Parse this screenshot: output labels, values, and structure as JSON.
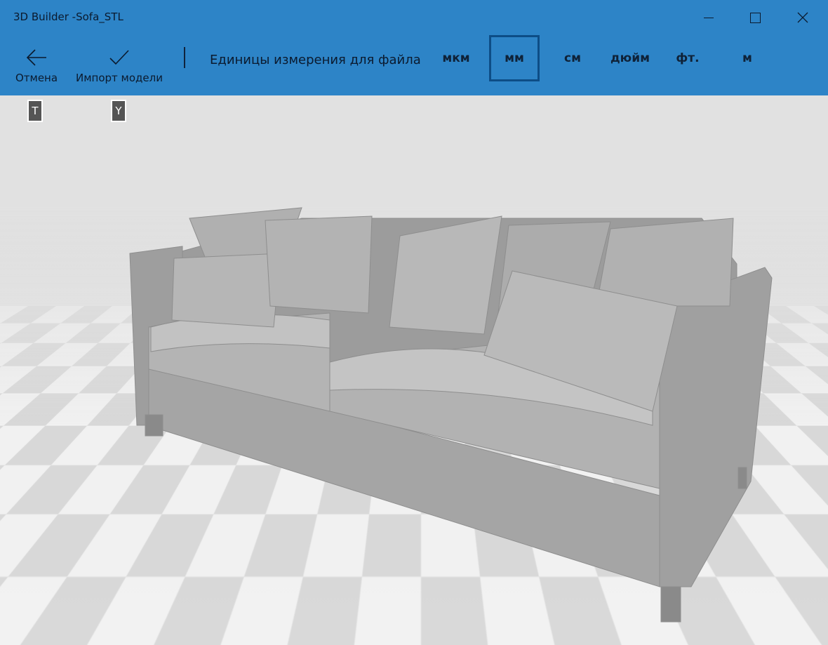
{
  "window": {
    "title": "3D Builder -Sofa_STL"
  },
  "toolbar": {
    "cancel_label": "Отмена",
    "import_label": "Импорт модели",
    "units_label": "Единицы измерения для файла",
    "units": [
      "мкм",
      "мм",
      "см",
      "дюйм",
      "фт.",
      "м"
    ],
    "selected_unit": "мм"
  },
  "shortcuts": {
    "cancel": "T",
    "import": "Y"
  },
  "colors": {
    "header": "#2d84c7",
    "selection_border": "#0d4d86"
  }
}
